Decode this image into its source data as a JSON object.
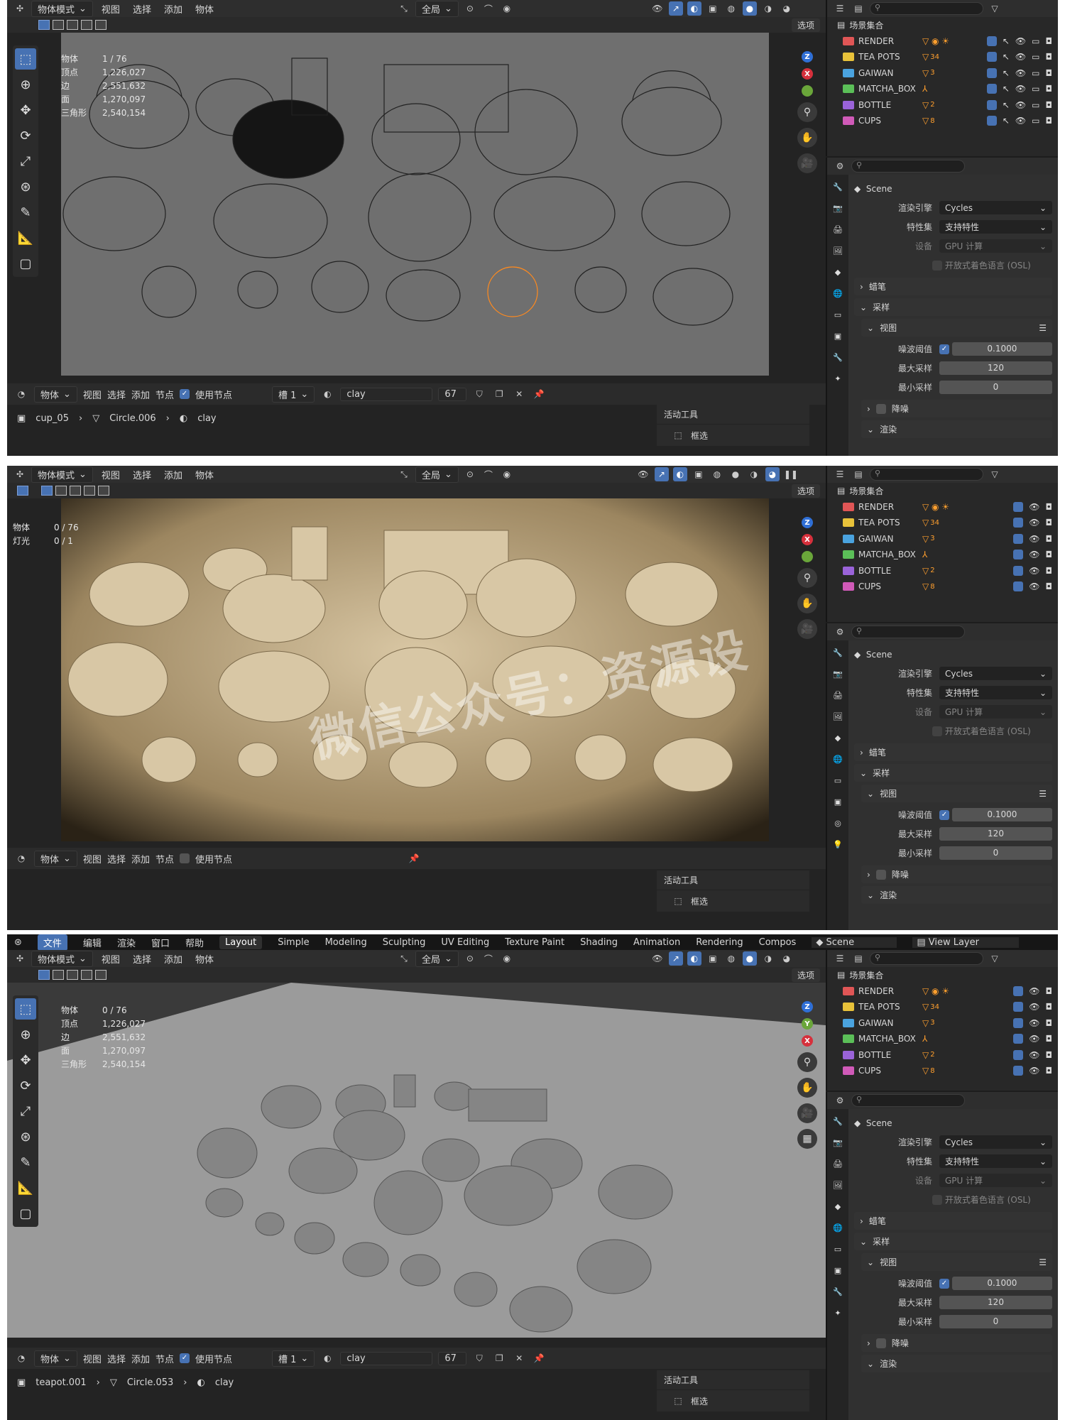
{
  "header": {
    "mode": "物体模式",
    "menu": [
      "视图",
      "选择",
      "添加",
      "物体"
    ],
    "orient": "全局",
    "options": "选项"
  },
  "panels": [
    {
      "id": "p1",
      "stats": [
        {
          "k": "物体",
          "v": "1 / 76"
        },
        {
          "k": "顶点",
          "v": "1,226,027"
        },
        {
          "k": "边",
          "v": "2,551,632"
        },
        {
          "k": "面",
          "v": "1,270,097"
        },
        {
          "k": "三角形",
          "v": "2,540,154"
        }
      ],
      "footer": {
        "mode": "物体",
        "menu": [
          "视图",
          "选择",
          "添加",
          "节点"
        ],
        "use_nodes": "使用节点",
        "slot": "槽 1",
        "material": "clay",
        "users": "67"
      },
      "breadcrumb": [
        "cup_05",
        "Circle.006",
        "clay"
      ],
      "active_tool": "活动工具",
      "tool_name": "框选",
      "denoise": "降噪",
      "render": "渲染"
    },
    {
      "id": "p2",
      "stats": [
        {
          "k": "物体",
          "v": "0 / 76"
        },
        {
          "k": "灯光",
          "v": "0 / 1"
        }
      ],
      "footer": {
        "mode": "物体",
        "menu": [
          "视图",
          "选择",
          "添加",
          "节点"
        ],
        "use_nodes": "使用节点"
      },
      "active_tool": "活动工具",
      "tool_name": "框选",
      "watermark": "微信公众号：资源设",
      "denoise": "降噪",
      "render": "渲染"
    },
    {
      "id": "p3",
      "stats": [
        {
          "k": "物体",
          "v": "0 / 76"
        },
        {
          "k": "顶点",
          "v": "1,226,027"
        },
        {
          "k": "边",
          "v": "2,551,632"
        },
        {
          "k": "面",
          "v": "1,270,097"
        },
        {
          "k": "三角形",
          "v": "2,540,154"
        }
      ],
      "footer": {
        "mode": "物体",
        "menu": [
          "视图",
          "选择",
          "添加",
          "节点"
        ],
        "use_nodes": "使用节点",
        "slot": "槽 1",
        "material": "clay",
        "users": "67"
      },
      "breadcrumb": [
        "teapot.001",
        "Circle.053",
        "clay"
      ],
      "active_tool": "活动工具",
      "tool_name": "框选",
      "denoise": "降噪",
      "render": "渲染"
    }
  ],
  "workspace": {
    "menu": [
      "文件",
      "编辑",
      "渲染",
      "窗口",
      "帮助"
    ],
    "tabs": [
      "Layout",
      "Simple",
      "Modeling",
      "Sculpting",
      "UV Editing",
      "Texture Paint",
      "Shading",
      "Animation",
      "Rendering",
      "Compos"
    ],
    "scene": "Scene",
    "view_layer": "View Layer"
  },
  "outliner": {
    "root": "场景集合",
    "collections": [
      {
        "name": "RENDER",
        "color": "#e05656",
        "badge": ""
      },
      {
        "name": "TEA POTS",
        "color": "#e8c23a",
        "badge": "34"
      },
      {
        "name": "GAIWAN",
        "color": "#4aa3df",
        "badge": "3"
      },
      {
        "name": "MATCHA_BOX",
        "color": "#5bbf58",
        "badge": ""
      },
      {
        "name": "BOTTLE",
        "color": "#9a63d9",
        "badge": "2"
      },
      {
        "name": "CUPS",
        "color": "#d05ab8",
        "badge": "8"
      }
    ]
  },
  "properties": {
    "scene": "Scene",
    "engine_label": "渲染引擎",
    "engine": "Cycles",
    "feature_label": "特性集",
    "feature": "支持特性",
    "device_label": "设备",
    "device": "GPU 计算",
    "osl": "开放式着色语言 (OSL)",
    "grease": "蜡笔",
    "sampling": "采样",
    "viewport": "视图",
    "noise_label": "噪波阈值",
    "noise": "0.1000",
    "max_label": "最大采样",
    "max": "120",
    "min_label": "最小采样",
    "min": "0"
  }
}
